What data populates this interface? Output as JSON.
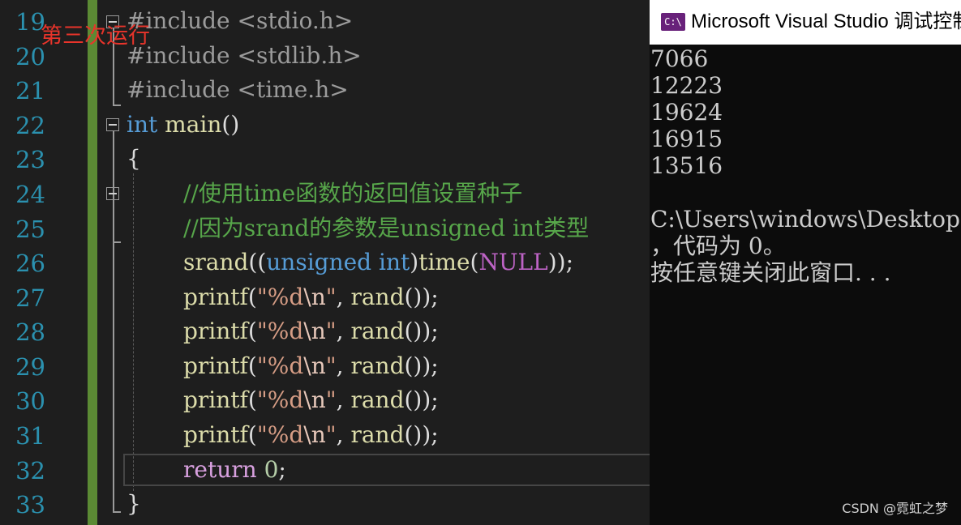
{
  "editor": {
    "annotation": "第三次运行",
    "line_numbers": [
      "19",
      "20",
      "21",
      "22",
      "23",
      "24",
      "25",
      "26",
      "27",
      "28",
      "29",
      "30",
      "31",
      "32",
      "33"
    ],
    "lines": [
      [
        {
          "t": "pre",
          "v": "#include <stdio.h>"
        }
      ],
      [
        {
          "t": "pre",
          "v": "#include <stdlib.h>"
        }
      ],
      [
        {
          "t": "pre",
          "v": "#include <time.h>"
        }
      ],
      [
        {
          "t": "kw",
          "v": "int"
        },
        {
          "t": "plain",
          "v": " "
        },
        {
          "t": "fn",
          "v": "main"
        },
        {
          "t": "plain",
          "v": "()"
        }
      ],
      [
        {
          "t": "plain",
          "v": "{"
        }
      ],
      [
        {
          "t": "cm",
          "v": "//使用time函数的返回值设置种子"
        }
      ],
      [
        {
          "t": "cm",
          "v": "//因为srand的参数是unsigned int类型"
        }
      ],
      [
        {
          "t": "fn",
          "v": "srand"
        },
        {
          "t": "plain",
          "v": "(("
        },
        {
          "t": "kw",
          "v": "unsigned int"
        },
        {
          "t": "plain",
          "v": ")"
        },
        {
          "t": "fn",
          "v": "time"
        },
        {
          "t": "plain",
          "v": "("
        },
        {
          "t": "macro",
          "v": "NULL"
        },
        {
          "t": "plain",
          "v": "));"
        }
      ],
      [
        {
          "t": "fn",
          "v": "printf"
        },
        {
          "t": "plain",
          "v": "("
        },
        {
          "t": "str",
          "v": "\"%d"
        },
        {
          "t": "esc",
          "v": "\\n"
        },
        {
          "t": "str",
          "v": "\""
        },
        {
          "t": "plain",
          "v": ", "
        },
        {
          "t": "fn",
          "v": "rand"
        },
        {
          "t": "plain",
          "v": "());"
        }
      ],
      [
        {
          "t": "fn",
          "v": "printf"
        },
        {
          "t": "plain",
          "v": "("
        },
        {
          "t": "str",
          "v": "\"%d"
        },
        {
          "t": "esc",
          "v": "\\n"
        },
        {
          "t": "str",
          "v": "\""
        },
        {
          "t": "plain",
          "v": ", "
        },
        {
          "t": "fn",
          "v": "rand"
        },
        {
          "t": "plain",
          "v": "());"
        }
      ],
      [
        {
          "t": "fn",
          "v": "printf"
        },
        {
          "t": "plain",
          "v": "("
        },
        {
          "t": "str",
          "v": "\"%d"
        },
        {
          "t": "esc",
          "v": "\\n"
        },
        {
          "t": "str",
          "v": "\""
        },
        {
          "t": "plain",
          "v": ", "
        },
        {
          "t": "fn",
          "v": "rand"
        },
        {
          "t": "plain",
          "v": "());"
        }
      ],
      [
        {
          "t": "fn",
          "v": "printf"
        },
        {
          "t": "plain",
          "v": "("
        },
        {
          "t": "str",
          "v": "\"%d"
        },
        {
          "t": "esc",
          "v": "\\n"
        },
        {
          "t": "str",
          "v": "\""
        },
        {
          "t": "plain",
          "v": ", "
        },
        {
          "t": "fn",
          "v": "rand"
        },
        {
          "t": "plain",
          "v": "());"
        }
      ],
      [
        {
          "t": "fn",
          "v": "printf"
        },
        {
          "t": "plain",
          "v": "("
        },
        {
          "t": "str",
          "v": "\"%d"
        },
        {
          "t": "esc",
          "v": "\\n"
        },
        {
          "t": "str",
          "v": "\""
        },
        {
          "t": "plain",
          "v": ", "
        },
        {
          "t": "fn",
          "v": "rand"
        },
        {
          "t": "plain",
          "v": "());"
        }
      ],
      [
        {
          "t": "ret",
          "v": "return"
        },
        {
          "t": "plain",
          "v": " "
        },
        {
          "t": "num",
          "v": "0"
        },
        {
          "t": "plain",
          "v": ";"
        }
      ],
      [
        {
          "t": "plain",
          "v": "}"
        }
      ]
    ]
  },
  "console": {
    "title": "Microsoft Visual Studio 调试控制台",
    "icon": "C:\\",
    "output": [
      "7066",
      "12223",
      "19624",
      "16915",
      "13516",
      "",
      "C:\\Users\\windows\\Desktop",
      "，代码为 0。",
      "按任意键关闭此窗口. . ."
    ]
  },
  "watermark": "CSDN @霓虹之梦",
  "colors": {
    "editor_bg": "#1e1e1e",
    "line_number": "#2b91af",
    "keyword": "#569cd6",
    "function": "#dcdcaa",
    "string": "#d69d85",
    "comment": "#57a64a",
    "preprocessor": "#9b9b9b",
    "return_keyword": "#d8a0df",
    "change_bar": "#5b8a34",
    "console_bg": "#0c0c0c",
    "annotation": "#e8342b"
  }
}
